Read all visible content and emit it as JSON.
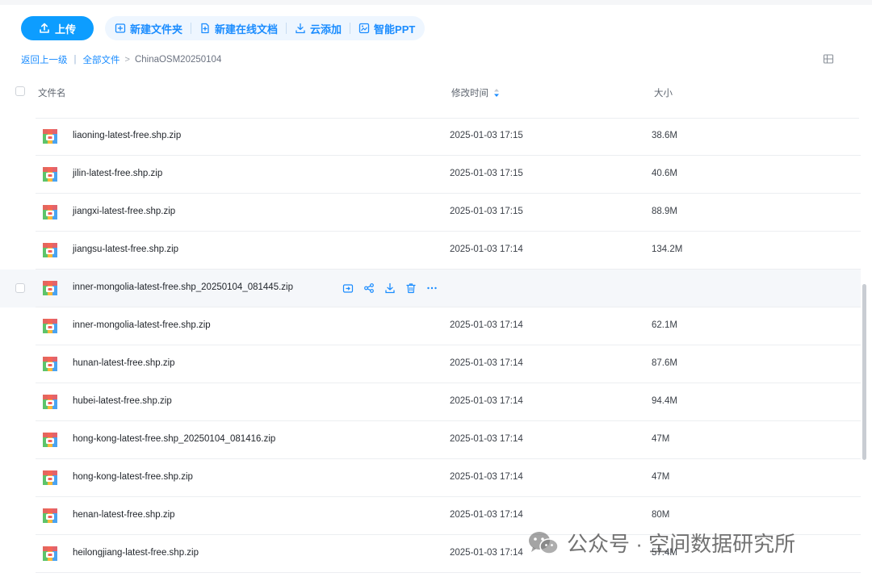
{
  "toolbar": {
    "upload_label": "上传",
    "new_folder_label": "新建文件夹",
    "new_doc_label": "新建在线文档",
    "cloud_add_label": "云添加",
    "smart_ppt_label": "智能PPT"
  },
  "breadcrumb": {
    "back": "返回上一级",
    "all_files": "全部文件",
    "separator": "|",
    "arrow": ">",
    "current": "ChinaOSM20250104"
  },
  "table_header": {
    "name": "文件名",
    "modified": "修改时间",
    "size": "大小"
  },
  "files": [
    {
      "name": "liaoning-latest-free.shp.zip",
      "time": "2025-01-03 17:15",
      "size": "38.6M"
    },
    {
      "name": "jilin-latest-free.shp.zip",
      "time": "2025-01-03 17:15",
      "size": "40.6M"
    },
    {
      "name": "jiangxi-latest-free.shp.zip",
      "time": "2025-01-03 17:15",
      "size": "88.9M"
    },
    {
      "name": "jiangsu-latest-free.shp.zip",
      "time": "2025-01-03 17:14",
      "size": "134.2M"
    },
    {
      "name": "inner-mongolia-latest-free.shp_20250104_081445.zip",
      "time": "",
      "size": ""
    },
    {
      "name": "inner-mongolia-latest-free.shp.zip",
      "time": "2025-01-03 17:14",
      "size": "62.1M"
    },
    {
      "name": "hunan-latest-free.shp.zip",
      "time": "2025-01-03 17:14",
      "size": "87.6M"
    },
    {
      "name": "hubei-latest-free.shp.zip",
      "time": "2025-01-03 17:14",
      "size": "94.4M"
    },
    {
      "name": "hong-kong-latest-free.shp_20250104_081416.zip",
      "time": "2025-01-03 17:14",
      "size": "47M"
    },
    {
      "name": "hong-kong-latest-free.shp.zip",
      "time": "2025-01-03 17:14",
      "size": "47M"
    },
    {
      "name": "henan-latest-free.shp.zip",
      "time": "2025-01-03 17:14",
      "size": "80M"
    },
    {
      "name": "heilongjiang-latest-free.shp.zip",
      "time": "2025-01-03 17:14",
      "size": "57.4M"
    }
  ],
  "hovered_row_actions": [
    "move-icon",
    "share-icon",
    "download-icon",
    "delete-icon",
    "more-icon"
  ],
  "file_icon": "zip-archive-icon",
  "watermark": {
    "text": "公众号 · 空间数据研究所"
  },
  "colors": {
    "accent": "#0d9dff",
    "link": "#1a8cff",
    "hover_row": "#f5f7fa"
  }
}
